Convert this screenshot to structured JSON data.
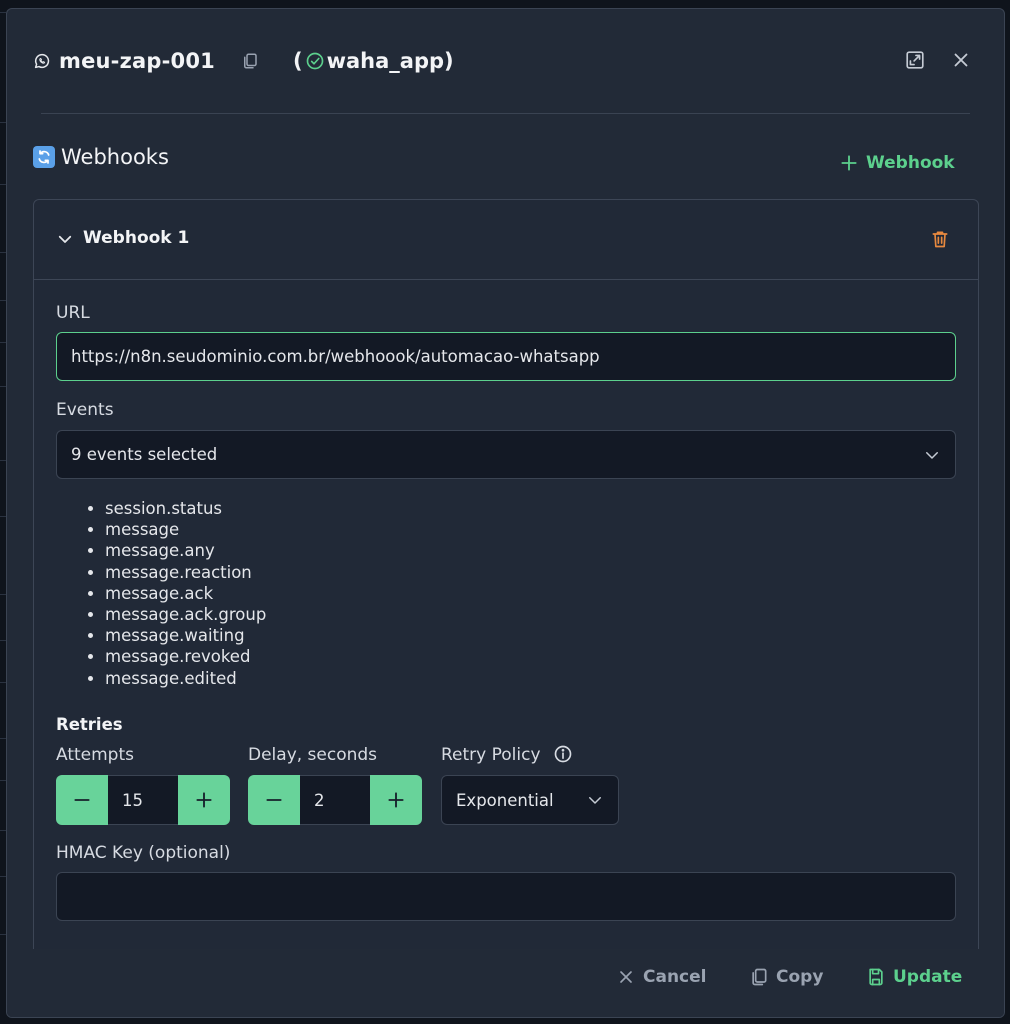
{
  "header": {
    "session_name": "meu-zap-001",
    "engine_open": "(",
    "engine_name": "waha_app",
    "engine_close": ")"
  },
  "section": {
    "title": "Webhooks",
    "add_label": "Webhook"
  },
  "webhook": {
    "name": "Webhook 1",
    "url_label": "URL",
    "url_value": "https://n8n.seudominio.com.br/webhoook/automacao-whatsapp",
    "events_label": "Events",
    "events_selected": "9 events selected",
    "events": [
      "session.status",
      "message",
      "message.any",
      "message.reaction",
      "message.ack",
      "message.ack.group",
      "message.waiting",
      "message.revoked",
      "message.edited"
    ],
    "retries_label": "Retries",
    "attempts_label": "Attempts",
    "attempts_value": "15",
    "delay_label": "Delay, seconds",
    "delay_value": "2",
    "policy_label": "Retry Policy",
    "policy_value": "Exponential",
    "hmac_label": "HMAC Key (optional)",
    "hmac_value": ""
  },
  "footer": {
    "cancel": "Cancel",
    "copy": "Copy",
    "update": "Update"
  },
  "colors": {
    "accent": "#5cd08d",
    "danger": "#e8893f",
    "background": "#222a37",
    "input_bg": "#131925"
  }
}
